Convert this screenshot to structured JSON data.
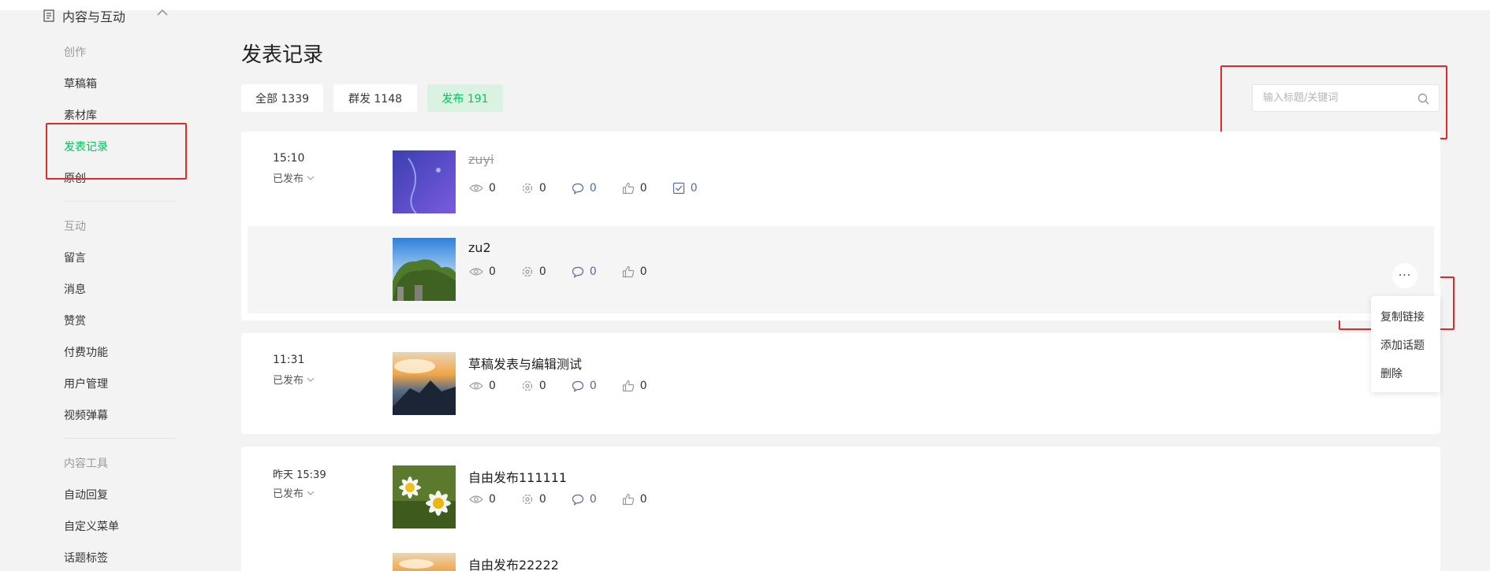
{
  "sidebar": {
    "group_title": "内容与互动",
    "sections": {
      "create": "创作",
      "interact": "互动",
      "tools": "内容工具"
    },
    "create_items": [
      "草稿箱",
      "素材库",
      "发表记录",
      "原创"
    ],
    "interact_items": [
      "留言",
      "消息",
      "赞赏",
      "付费功能",
      "用户管理",
      "视频弹幕"
    ],
    "tool_items": [
      "自动回复",
      "自定义菜单",
      "话题标签"
    ]
  },
  "page": {
    "title": "发表记录"
  },
  "tabs": [
    {
      "label": "全部 1339",
      "active": false
    },
    {
      "label": "群发 1148",
      "active": false
    },
    {
      "label": "发布 191",
      "active": true
    }
  ],
  "search": {
    "placeholder": "输入标题/关键词",
    "value": ""
  },
  "cards": [
    {
      "time": "15:10",
      "status": "已发布",
      "articles": [
        {
          "title": "zuyi",
          "deleted": true,
          "reads": "0",
          "shares": "0",
          "comments": "0",
          "likes": "0",
          "checks": "0"
        },
        {
          "title": "zu2",
          "deleted": false,
          "reads": "0",
          "shares": "0",
          "comments": "0",
          "likes": "0"
        }
      ]
    },
    {
      "time": "11:31",
      "status": "已发布",
      "articles": [
        {
          "title": "草稿发表与编辑测试",
          "reads": "0",
          "shares": "0",
          "comments": "0",
          "likes": "0"
        }
      ]
    },
    {
      "time": "昨天 15:39",
      "status": "已发布",
      "articles": [
        {
          "title": "自由发布111111",
          "reads": "0",
          "shares": "0",
          "comments": "0",
          "likes": "0"
        },
        {
          "title": "自由发布22222"
        }
      ]
    }
  ],
  "more_button": "···",
  "context_menu": [
    "复制链接",
    "添加话题",
    "删除"
  ],
  "colors": {
    "accent": "#07c160",
    "accent_bg": "#d9f2e1",
    "annotation_red": "#e02a2a",
    "link_blue": "#576b95"
  }
}
